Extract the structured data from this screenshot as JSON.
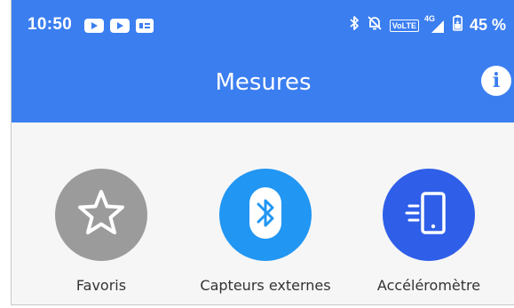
{
  "status_bar": {
    "time": "10:50",
    "battery": "45 %",
    "volte": "VoLTE",
    "network": "4G",
    "icons": [
      "youtube-icon",
      "youtube-icon",
      "message-icon",
      "bluetooth-icon",
      "mute-icon",
      "signal-icon",
      "battery-icon"
    ]
  },
  "app_bar": {
    "title": "Mesures",
    "info_icon": "i"
  },
  "tiles": [
    {
      "label": "Favoris",
      "icon": "star-icon",
      "color": "#9b9b9b"
    },
    {
      "label": "Capteurs externes",
      "icon": "bluetooth-icon",
      "color": "#2196f3"
    },
    {
      "label": "Accéléromètre",
      "icon": "phone-motion-icon",
      "color": "#2f5fe8"
    }
  ],
  "colors": {
    "primary": "#3b7ef0",
    "background": "#f6f6f6"
  }
}
